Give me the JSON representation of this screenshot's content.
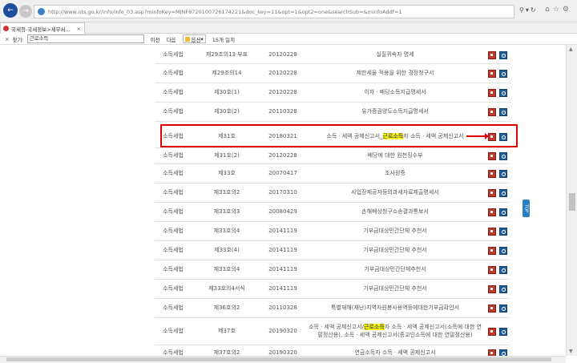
{
  "browser": {
    "url": "http://www.nts.go.kr/info/info_03.asp?minfoKey=MINF8720100726174221&doc_key=11&opt=1&opt2=one&searchSub=&minfoAddf=1",
    "tab_title": "국세청-국세정보>세무서..."
  },
  "find_bar": {
    "label": "찾기:",
    "query": "근로소득",
    "prev": "이전",
    "next": "다음",
    "options": "옵션",
    "match_count": "15개 일치"
  },
  "highlight_term": "근로소득",
  "rows": [
    {
      "law": "소득세법",
      "article": "제29조의13 부표",
      "date": "20120228",
      "name": "실질귀속자 명세"
    },
    {
      "law": "소득세법",
      "article": "제29조의14",
      "date": "20120228",
      "name": "제한세율 적용을 위한 경정청구서"
    },
    {
      "law": "소득세법",
      "article": "제30호(1)",
      "date": "20120228",
      "name": "이자ㆍ배당소득지급명세서"
    },
    {
      "law": "소득세법",
      "article": "제30호(2)",
      "date": "20110328",
      "name": "유가증권양도소득지급명세서"
    },
    {
      "law": "소득세법",
      "article": "제31호",
      "date": "20180321",
      "name_parts": [
        "소득ㆍ세액 공제신고서_",
        "근로소득",
        "자 소득ㆍ세액 공제신고서"
      ]
    },
    {
      "law": "소득세법",
      "article": "제31호(2)",
      "date": "20120228",
      "name": "배당에 대한 원천징수부"
    },
    {
      "law": "소득세법",
      "article": "제33호",
      "date": "20070417",
      "name": "조사원증"
    },
    {
      "law": "소득세법",
      "article": "제33호의2",
      "date": "20170310",
      "name": "사업장제공자등의과세자료제출명세서"
    },
    {
      "law": "소득세법",
      "article": "제33호의3",
      "date": "20080429",
      "name": "손해배상청구소송결과통보서"
    },
    {
      "law": "소득세법",
      "article": "제33호의4",
      "date": "20141119",
      "name": "기부금대상민간단체 추천서"
    },
    {
      "law": "소득세법",
      "article": "제33호(4)",
      "date": "20141119",
      "name": "기부금대상민간단체 추천서"
    },
    {
      "law": "소득세법",
      "article": "제33호의4",
      "date": "20141119",
      "name": "기부금대상민간단체추천서"
    },
    {
      "law": "소득세법",
      "article": "제33호의4서식",
      "date": "20141119",
      "name": "기부금대상민간단체 추천서"
    },
    {
      "law": "소득세법",
      "article": "제36호의2",
      "date": "20110328",
      "name": "특별재해(재난)지역자원봉사용역등에대한기부금확인서"
    },
    {
      "law": "소득세법",
      "article": "제37호",
      "date": "20190320",
      "name_parts": [
        "소득ㆍ세액 공제신고서/",
        "근로소득",
        "자 소득ㆍ세액 공제신고서(소득에 대한 연말정산용), 소득ㆍ세액 공제신고서(종교인소득에 대한 연말정산용)"
      ]
    },
    {
      "law": "소득세법",
      "article": "제37호의2",
      "date": "20190320",
      "name": "연금소득자 소득ㆍ세액 공제신고서"
    }
  ],
  "side_tab_label": "TOP",
  "colors": {
    "highlight": "#ffff00",
    "annotation": "#e00000",
    "pdf_icon": "#c0392b",
    "view_icon": "#1f5e9e"
  },
  "icons": [
    "back-arrow-icon",
    "forward-arrow-icon",
    "globe-icon",
    "search-icon",
    "refresh-icon",
    "home-icon",
    "star-icon",
    "gear-icon",
    "pdf-icon",
    "magnifier-icon",
    "close-icon"
  ]
}
